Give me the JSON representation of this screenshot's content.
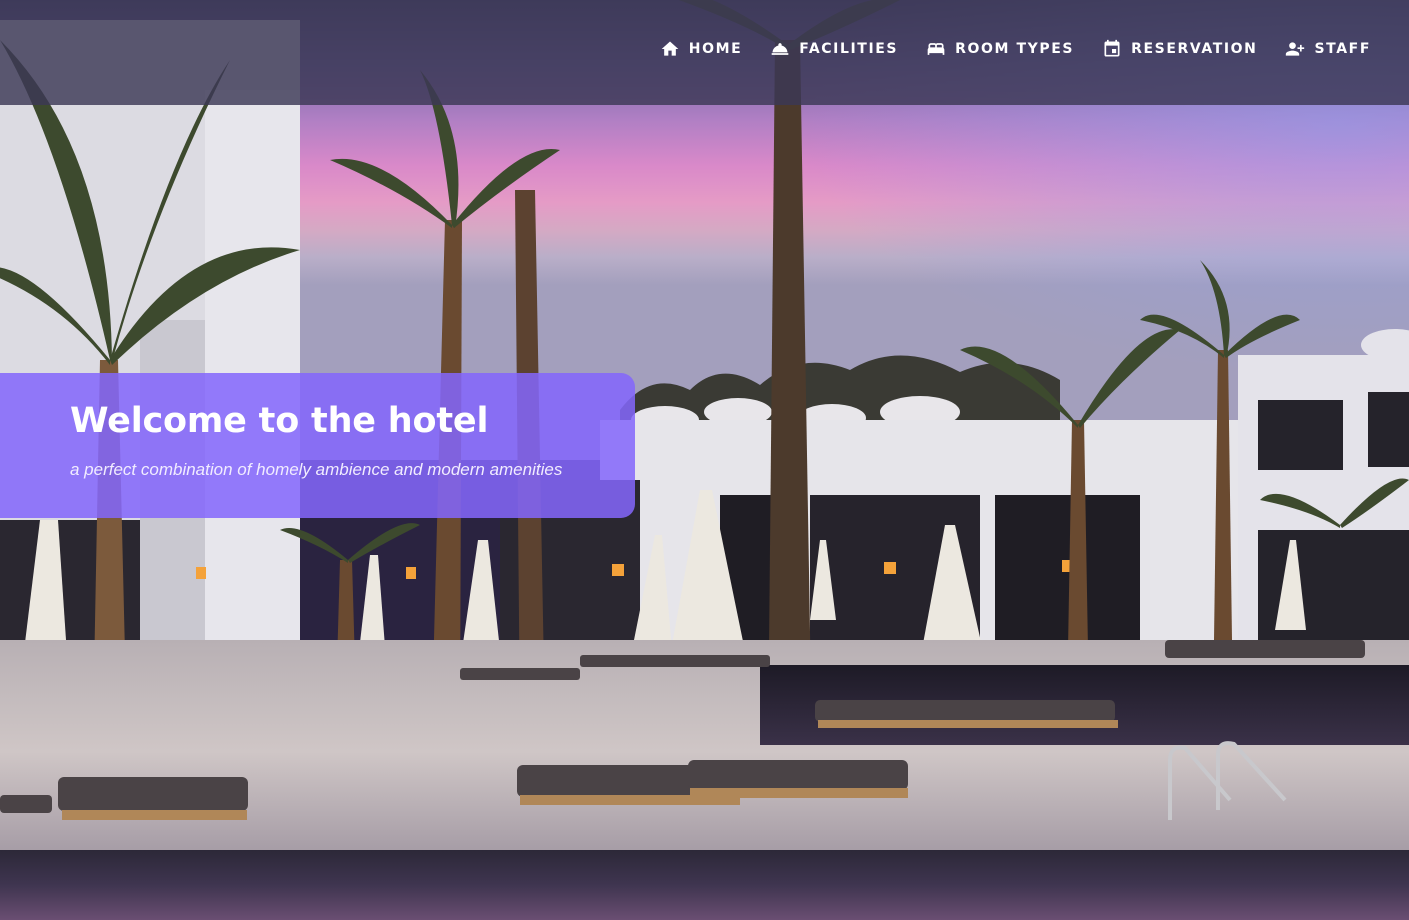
{
  "nav": {
    "items": [
      {
        "label": "HOME",
        "icon": "home-icon"
      },
      {
        "label": "FACILITIES",
        "icon": "facilities-icon"
      },
      {
        "label": "ROOM TYPES",
        "icon": "bed-icon"
      },
      {
        "label": "RESERVATION",
        "icon": "calendar-icon"
      },
      {
        "label": "STAFF",
        "icon": "staff-icon"
      }
    ]
  },
  "hero": {
    "title": "Welcome to the hotel",
    "subtitle": "a perfect combination of homely ambience and modern amenities"
  },
  "colors": {
    "navbar_bg": "#3c3856",
    "banner_bg": "#8466fc",
    "text": "#ffffff"
  }
}
